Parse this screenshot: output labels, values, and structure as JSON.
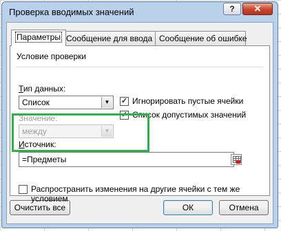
{
  "window": {
    "title": "Проверка вводимых значений",
    "help_label": "?",
    "close_label": "✕"
  },
  "tabs": [
    {
      "label": "Параметры",
      "active": true
    },
    {
      "label": "Сообщение для ввода",
      "active": false
    },
    {
      "label": "Сообщение об ошибке",
      "active": false
    }
  ],
  "validation": {
    "group_label": "Условие проверки",
    "data_type_label": "Тип данных:",
    "data_type_value": "Список",
    "ignore_blank_label": "Игнорировать пустые ячейки",
    "ignore_blank_checked": true,
    "in_cell_dropdown_label": "Список допустимых значений",
    "in_cell_dropdown_checked": true,
    "condition_label": "Значение:",
    "condition_value": "между",
    "source_label": "Источник:",
    "source_value": "=Предметы"
  },
  "apply_all_label": "Распространить изменения на другие ячейки с тем же условием",
  "apply_all_checked": false,
  "buttons": {
    "clear_all": "Очистить все",
    "ok": "ОК",
    "cancel": "Отмена"
  },
  "colors": {
    "highlight": "#2db24b",
    "frame": "#b9d1ea",
    "close_button": "#c7452a"
  }
}
